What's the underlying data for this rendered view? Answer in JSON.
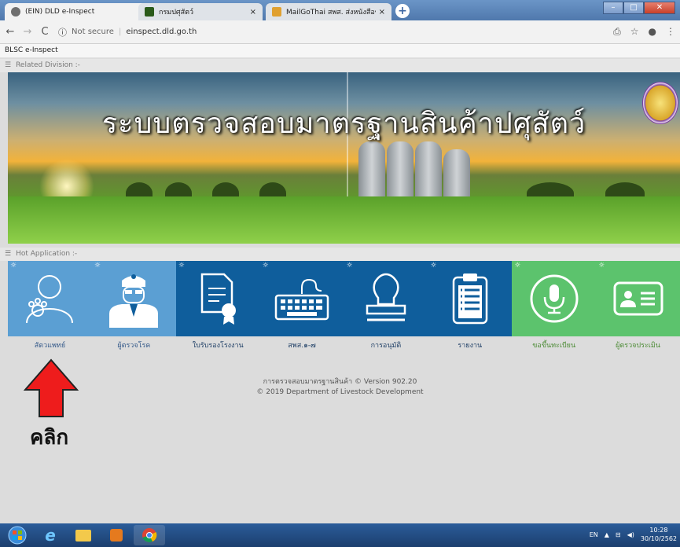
{
  "browser": {
    "tabs": [
      {
        "title": "(EIN) DLD e-Inspect",
        "close": "×",
        "active": true
      },
      {
        "title": "กรมปศุสัตว์",
        "close": "×",
        "active": false
      },
      {
        "title": "MailGoThai สพส. ส่งหนังสือขอยา",
        "close": "×",
        "active": false
      }
    ],
    "new_tab": "+",
    "security": "Not secure",
    "url": "einspect.dld.go.th"
  },
  "page": {
    "app_name": "BLSC e-Inspect",
    "related_division": "Related Division :-",
    "hot_application": "Hot Application :-",
    "banner_title": "ระบบตรวจสอบมาตรฐานสินค้าปศุสัตว์"
  },
  "tiles": [
    {
      "label": "สัตวแพทย์",
      "color": "#5b9fd3",
      "icon": "vet-icon"
    },
    {
      "label": "ผู้ตรวจโรค",
      "color": "#5b9fd3",
      "icon": "inspector-icon"
    },
    {
      "label": "ใบรับรองโรงงาน",
      "color": "#0f5e9c",
      "icon": "certificate-icon"
    },
    {
      "label": "สพส.๑-๗",
      "color": "#0f5e9c",
      "icon": "keyboard-icon"
    },
    {
      "label": "การอนุมัติ",
      "color": "#0f5e9c",
      "icon": "stamp-icon"
    },
    {
      "label": "รายงาน",
      "color": "#0f5e9c",
      "icon": "clipboard-icon"
    },
    {
      "label": "ขอขึ้นทะเบียน",
      "color": "#5cc36d",
      "icon": "microphone-icon"
    },
    {
      "label": "ผู้ตรวจประเมิน",
      "color": "#5cc36d",
      "icon": "id-card-icon"
    }
  ],
  "footer": {
    "line1": "การตรวจสอบมาตรฐานสินค้า © Version 902.20",
    "line2": "© 2019 Department of Livestock Development"
  },
  "annotation": {
    "text": "คลิก",
    "color": "#ee1c1c"
  },
  "taskbar": {
    "lang": "EN",
    "time": "10:28",
    "date": "30/10/2562"
  }
}
